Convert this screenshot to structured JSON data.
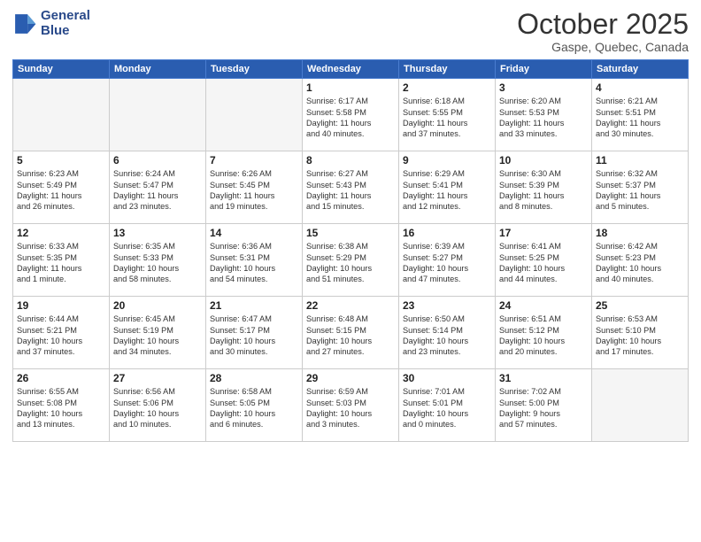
{
  "header": {
    "logo_line1": "General",
    "logo_line2": "Blue",
    "month": "October 2025",
    "location": "Gaspe, Quebec, Canada"
  },
  "days_of_week": [
    "Sunday",
    "Monday",
    "Tuesday",
    "Wednesday",
    "Thursday",
    "Friday",
    "Saturday"
  ],
  "weeks": [
    [
      {
        "day": "",
        "info": ""
      },
      {
        "day": "",
        "info": ""
      },
      {
        "day": "",
        "info": ""
      },
      {
        "day": "1",
        "info": "Sunrise: 6:17 AM\nSunset: 5:58 PM\nDaylight: 11 hours\nand 40 minutes."
      },
      {
        "day": "2",
        "info": "Sunrise: 6:18 AM\nSunset: 5:55 PM\nDaylight: 11 hours\nand 37 minutes."
      },
      {
        "day": "3",
        "info": "Sunrise: 6:20 AM\nSunset: 5:53 PM\nDaylight: 11 hours\nand 33 minutes."
      },
      {
        "day": "4",
        "info": "Sunrise: 6:21 AM\nSunset: 5:51 PM\nDaylight: 11 hours\nand 30 minutes."
      }
    ],
    [
      {
        "day": "5",
        "info": "Sunrise: 6:23 AM\nSunset: 5:49 PM\nDaylight: 11 hours\nand 26 minutes."
      },
      {
        "day": "6",
        "info": "Sunrise: 6:24 AM\nSunset: 5:47 PM\nDaylight: 11 hours\nand 23 minutes."
      },
      {
        "day": "7",
        "info": "Sunrise: 6:26 AM\nSunset: 5:45 PM\nDaylight: 11 hours\nand 19 minutes."
      },
      {
        "day": "8",
        "info": "Sunrise: 6:27 AM\nSunset: 5:43 PM\nDaylight: 11 hours\nand 15 minutes."
      },
      {
        "day": "9",
        "info": "Sunrise: 6:29 AM\nSunset: 5:41 PM\nDaylight: 11 hours\nand 12 minutes."
      },
      {
        "day": "10",
        "info": "Sunrise: 6:30 AM\nSunset: 5:39 PM\nDaylight: 11 hours\nand 8 minutes."
      },
      {
        "day": "11",
        "info": "Sunrise: 6:32 AM\nSunset: 5:37 PM\nDaylight: 11 hours\nand 5 minutes."
      }
    ],
    [
      {
        "day": "12",
        "info": "Sunrise: 6:33 AM\nSunset: 5:35 PM\nDaylight: 11 hours\nand 1 minute."
      },
      {
        "day": "13",
        "info": "Sunrise: 6:35 AM\nSunset: 5:33 PM\nDaylight: 10 hours\nand 58 minutes."
      },
      {
        "day": "14",
        "info": "Sunrise: 6:36 AM\nSunset: 5:31 PM\nDaylight: 10 hours\nand 54 minutes."
      },
      {
        "day": "15",
        "info": "Sunrise: 6:38 AM\nSunset: 5:29 PM\nDaylight: 10 hours\nand 51 minutes."
      },
      {
        "day": "16",
        "info": "Sunrise: 6:39 AM\nSunset: 5:27 PM\nDaylight: 10 hours\nand 47 minutes."
      },
      {
        "day": "17",
        "info": "Sunrise: 6:41 AM\nSunset: 5:25 PM\nDaylight: 10 hours\nand 44 minutes."
      },
      {
        "day": "18",
        "info": "Sunrise: 6:42 AM\nSunset: 5:23 PM\nDaylight: 10 hours\nand 40 minutes."
      }
    ],
    [
      {
        "day": "19",
        "info": "Sunrise: 6:44 AM\nSunset: 5:21 PM\nDaylight: 10 hours\nand 37 minutes."
      },
      {
        "day": "20",
        "info": "Sunrise: 6:45 AM\nSunset: 5:19 PM\nDaylight: 10 hours\nand 34 minutes."
      },
      {
        "day": "21",
        "info": "Sunrise: 6:47 AM\nSunset: 5:17 PM\nDaylight: 10 hours\nand 30 minutes."
      },
      {
        "day": "22",
        "info": "Sunrise: 6:48 AM\nSunset: 5:15 PM\nDaylight: 10 hours\nand 27 minutes."
      },
      {
        "day": "23",
        "info": "Sunrise: 6:50 AM\nSunset: 5:14 PM\nDaylight: 10 hours\nand 23 minutes."
      },
      {
        "day": "24",
        "info": "Sunrise: 6:51 AM\nSunset: 5:12 PM\nDaylight: 10 hours\nand 20 minutes."
      },
      {
        "day": "25",
        "info": "Sunrise: 6:53 AM\nSunset: 5:10 PM\nDaylight: 10 hours\nand 17 minutes."
      }
    ],
    [
      {
        "day": "26",
        "info": "Sunrise: 6:55 AM\nSunset: 5:08 PM\nDaylight: 10 hours\nand 13 minutes."
      },
      {
        "day": "27",
        "info": "Sunrise: 6:56 AM\nSunset: 5:06 PM\nDaylight: 10 hours\nand 10 minutes."
      },
      {
        "day": "28",
        "info": "Sunrise: 6:58 AM\nSunset: 5:05 PM\nDaylight: 10 hours\nand 6 minutes."
      },
      {
        "day": "29",
        "info": "Sunrise: 6:59 AM\nSunset: 5:03 PM\nDaylight: 10 hours\nand 3 minutes."
      },
      {
        "day": "30",
        "info": "Sunrise: 7:01 AM\nSunset: 5:01 PM\nDaylight: 10 hours\nand 0 minutes."
      },
      {
        "day": "31",
        "info": "Sunrise: 7:02 AM\nSunset: 5:00 PM\nDaylight: 9 hours\nand 57 minutes."
      },
      {
        "day": "",
        "info": ""
      }
    ]
  ]
}
